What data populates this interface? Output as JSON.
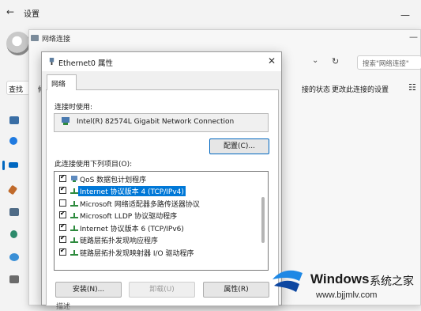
{
  "settings": {
    "title": "设置",
    "find_placeholder": "查找"
  },
  "network_window": {
    "title": "网络连接",
    "search_placeholder": "搜索\"网络连接\"",
    "commands": [
      "接的状态",
      "更改此连接的设置"
    ],
    "partial_left": "修"
  },
  "dialog": {
    "title": "Ethernet0 属性",
    "tab_label": "网络",
    "connect_using_label": "连接时使用:",
    "adapter_name": "Intel(R) 82574L Gigabit Network Connection",
    "configure_button": "配置(C)...",
    "items_label": "此连接使用下列项目(O):",
    "items": [
      {
        "label": "QoS 数据包计划程序",
        "checked": true,
        "icon": "qos-icon",
        "selected": false
      },
      {
        "label": "Internet 协议版本 4 (TCP/IPv4)",
        "checked": true,
        "icon": "protocol-icon",
        "selected": true
      },
      {
        "label": "Microsoft 网络适配器多路传送器协议",
        "checked": false,
        "icon": "protocol-icon",
        "selected": false
      },
      {
        "label": "Microsoft LLDP 协议驱动程序",
        "checked": true,
        "icon": "protocol-icon",
        "selected": false
      },
      {
        "label": "Internet 协议版本 6 (TCP/IPv6)",
        "checked": true,
        "icon": "protocol-icon",
        "selected": false
      },
      {
        "label": "链路层拓扑发现响应程序",
        "checked": true,
        "icon": "protocol-icon",
        "selected": false
      },
      {
        "label": "链路层拓扑发现映射器 I/O 驱动程序",
        "checked": true,
        "icon": "protocol-icon",
        "selected": false
      }
    ],
    "install_button": "安装(N)...",
    "uninstall_button": "卸载(U)",
    "properties_button": "属性(R)",
    "description_label": "描述"
  },
  "watermark": {
    "brand": "Windows",
    "brand_cn": "系统之家",
    "url": "www.bjjmlv.com"
  },
  "colors": {
    "selection": "#0078d7",
    "accent": "#0067c0"
  }
}
